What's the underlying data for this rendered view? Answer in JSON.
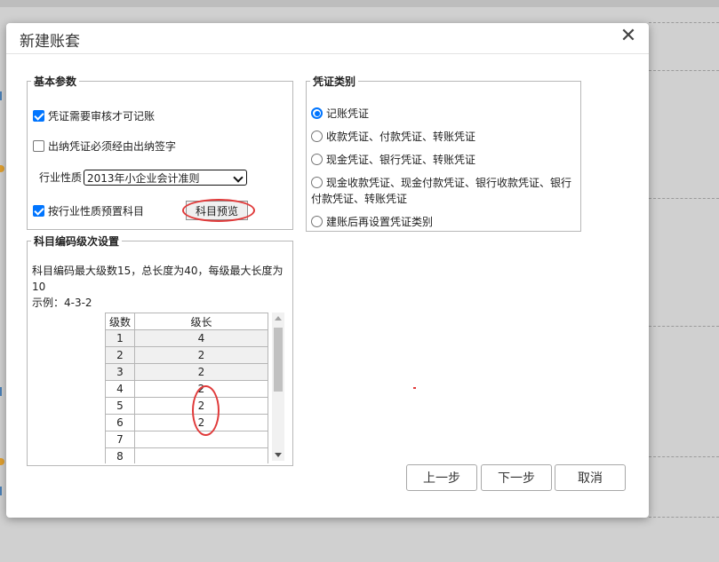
{
  "dialog": {
    "title": "新建账套",
    "close_glyph": "✕"
  },
  "basic": {
    "legend": "基本参数",
    "voucher_review": {
      "label": "凭证需要审核才可记账",
      "checked": true
    },
    "cashier_sign": {
      "label": "出纳凭证必须经由出纳签字",
      "checked": false
    },
    "industry": {
      "label": "行业性质",
      "selected": "2013年小企业会计准则"
    },
    "preset_accounts": {
      "label": "按行业性质预置科目",
      "checked": true
    },
    "preview_button": "科目预览"
  },
  "voucher_types": {
    "legend": "凭证类别",
    "options": [
      {
        "label": "记账凭证",
        "selected": true
      },
      {
        "label": "收款凭证、付款凭证、转账凭证",
        "selected": false
      },
      {
        "label": "现金凭证、银行凭证、转账凭证",
        "selected": false
      },
      {
        "label": "现金收款凭证、现金付款凭证、银行收款凭证、银行",
        "label_cont": "付款凭证、转账凭证",
        "selected": false
      },
      {
        "label": "建账后再设置凭证类别",
        "selected": false
      }
    ]
  },
  "coding": {
    "legend": "科目编码级次设置",
    "desc_line1": "科目编码最大级数15，总长度为40，每级最大长度为",
    "desc_line2": "10",
    "example": "示例：4-3-2",
    "columns": [
      "级数",
      "级长"
    ],
    "rows": [
      {
        "level": "1",
        "length": "4"
      },
      {
        "level": "2",
        "length": "2"
      },
      {
        "level": "3",
        "length": "2"
      },
      {
        "level": "4",
        "length": "2"
      },
      {
        "level": "5",
        "length": "2"
      },
      {
        "level": "6",
        "length": "2"
      },
      {
        "level": "7",
        "length": ""
      },
      {
        "level": "8",
        "length": ""
      }
    ]
  },
  "footer": {
    "prev": "上一步",
    "next": "下一步",
    "cancel": "取消"
  },
  "colors": {
    "accent": "#0075ff",
    "annotation": "#e03a3a"
  }
}
